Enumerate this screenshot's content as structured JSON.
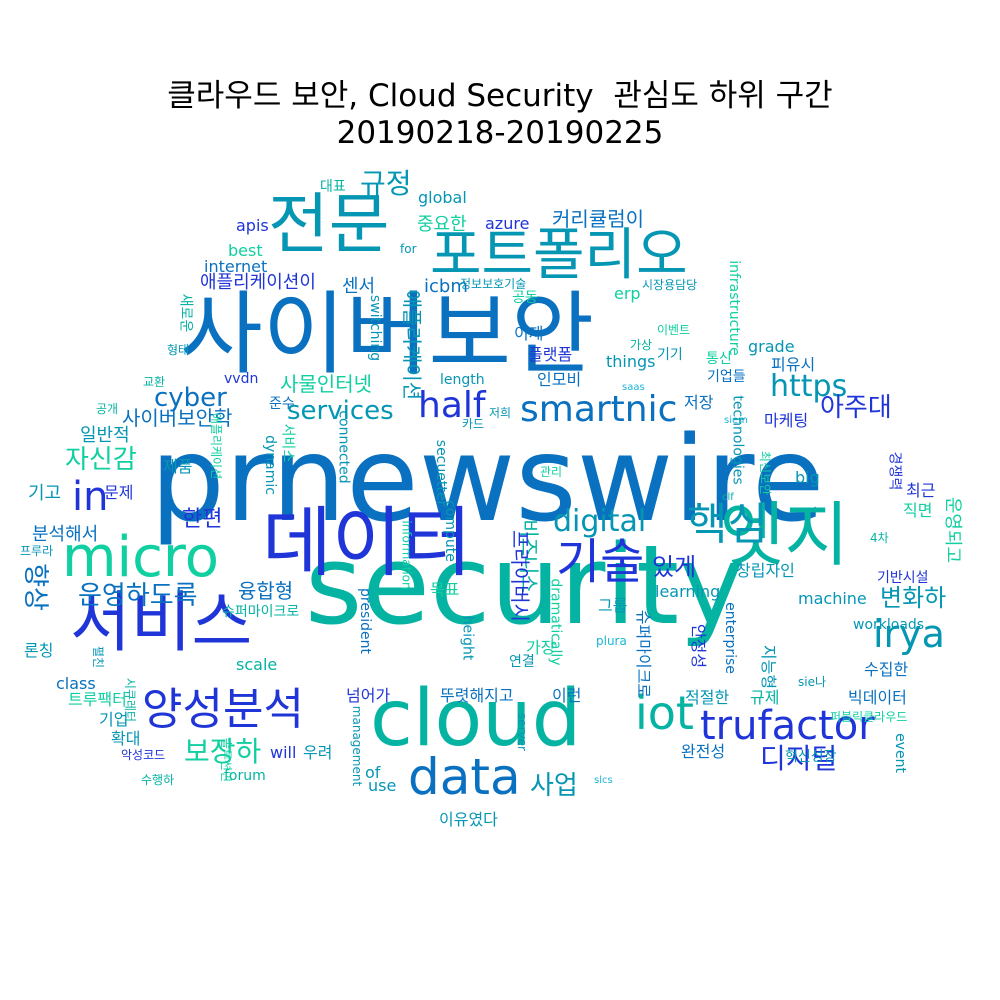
{
  "figure": {
    "title_line1": "클라우드 보안, Cloud Security  관심도 하위 구간",
    "title_line2": "20190218-20190225"
  },
  "palette": [
    "#1f35d8",
    "#0a71c0",
    "#0596b4",
    "#05b3a3",
    "#10cfa0",
    "#1ab5d6"
  ],
  "words": [
    {
      "text": "prnewswire",
      "color": "#0a71c0"
    },
    {
      "text": "security",
      "color": "#05b3a3"
    },
    {
      "text": "사이버보안",
      "color": "#0a71c0"
    },
    {
      "text": "데이터",
      "color": "#1f35d8"
    },
    {
      "text": "cloud",
      "color": "#05b3a3"
    },
    {
      "text": "서비스",
      "color": "#1f35d8"
    },
    {
      "text": "엣지",
      "color": "#05b3a3"
    },
    {
      "text": "전문",
      "color": "#0596b4"
    },
    {
      "text": "micro",
      "color": "#10cfa0"
    },
    {
      "text": "포트폴리오",
      "color": "#0596b4"
    },
    {
      "text": "data",
      "color": "#0a71c0"
    },
    {
      "text": "양성분석",
      "color": "#1f35d8"
    },
    {
      "text": "기술",
      "color": "#1f35d8"
    },
    {
      "text": "핵심",
      "color": "#0596b4"
    },
    {
      "text": "trufactor",
      "color": "#1f35d8"
    },
    {
      "text": "smartnic",
      "color": "#0a71c0"
    },
    {
      "text": "iot",
      "color": "#05b3a3"
    },
    {
      "text": "half",
      "color": "#1f35d8"
    },
    {
      "text": "irya",
      "color": "#0596b4"
    },
    {
      "text": "in",
      "color": "#1f35d8"
    },
    {
      "text": "digital",
      "color": "#0596b4"
    },
    {
      "text": "https",
      "color": "#0596b4"
    },
    {
      "text": "보장하",
      "color": "#10cfa0"
    },
    {
      "text": "디지털",
      "color": "#1f35d8"
    },
    {
      "text": "운영하도록",
      "color": "#0a71c0"
    },
    {
      "text": "사업",
      "color": "#0596b4"
    },
    {
      "text": "자신감",
      "color": "#10cfa0"
    },
    {
      "text": "services",
      "color": "#0596b4"
    },
    {
      "text": "있게",
      "color": "#1f35d8"
    },
    {
      "text": "변화하",
      "color": "#0596b4"
    },
    {
      "text": "규정",
      "color": "#0596b4"
    },
    {
      "text": "cyber",
      "color": "#0a71c0"
    },
    {
      "text": "아주대",
      "color": "#1f35d8"
    },
    {
      "text": "향상",
      "color": "#0a71c0"
    },
    {
      "text": "한편",
      "color": "#1f35d8"
    },
    {
      "text": "사물인터넷",
      "color": "#10cfa0"
    },
    {
      "text": "사이버보안학",
      "color": "#0a71c0"
    },
    {
      "text": "애플리케이션",
      "color": "#0596b4"
    },
    {
      "text": "비즈니스",
      "color": "#05b3a3"
    },
    {
      "text": "프라이버시",
      "color": "#1f35d8"
    },
    {
      "text": "융합형",
      "color": "#0a71c0"
    },
    {
      "text": "커리큘럼이",
      "color": "#0a71c0"
    },
    {
      "text": "중요한",
      "color": "#10cfa0"
    },
    {
      "text": "azure",
      "color": "#1f35d8"
    },
    {
      "text": "global",
      "color": "#0596b4"
    },
    {
      "text": "대표",
      "color": "#05b3a3"
    },
    {
      "text": "apis",
      "color": "#1f35d8"
    },
    {
      "text": "best",
      "color": "#10cfa0"
    },
    {
      "text": "for",
      "color": "#0596b4"
    },
    {
      "text": "internet",
      "color": "#0a71c0"
    },
    {
      "text": "애플리케이션이",
      "color": "#1f35d8"
    },
    {
      "text": "icbm",
      "color": "#0a71c0"
    },
    {
      "text": "정보보호기술",
      "color": "#0596b4"
    },
    {
      "text": "erp",
      "color": "#10cfa0"
    },
    {
      "text": "시장용담당",
      "color": "#0596b4"
    },
    {
      "text": "infrastructure",
      "color": "#10cfa0"
    },
    {
      "text": "센서",
      "color": "#0a71c0"
    },
    {
      "text": "공동",
      "color": "#10cfa0"
    },
    {
      "text": "switching",
      "color": "#0596b4"
    },
    {
      "text": "이제",
      "color": "#0a71c0"
    },
    {
      "text": "이벤트",
      "color": "#10cfa0"
    },
    {
      "text": "기기",
      "color": "#0596b4"
    },
    {
      "text": "가상",
      "color": "#05b3a3"
    },
    {
      "text": "grade",
      "color": "#0596b4"
    },
    {
      "text": "플랫폼",
      "color": "#1f35d8"
    },
    {
      "text": "통신",
      "color": "#10cfa0"
    },
    {
      "text": "피유시",
      "color": "#0a71c0"
    },
    {
      "text": "things",
      "color": "#0596b4"
    },
    {
      "text": "기업들",
      "color": "#0a71c0"
    },
    {
      "text": "인모비",
      "color": "#0a71c0"
    },
    {
      "text": "saas",
      "color": "#1ab5d6"
    },
    {
      "text": "vvdn",
      "color": "#1f35d8"
    },
    {
      "text": "length",
      "color": "#0596b4"
    },
    {
      "text": "준수",
      "color": "#0a71c0"
    },
    {
      "text": "저장",
      "color": "#0a71c0"
    },
    {
      "text": "마케팅",
      "color": "#1f35d8"
    },
    {
      "text": "새로운",
      "color": "#05b3a3"
    },
    {
      "text": "형태",
      "color": "#0596b4"
    },
    {
      "text": "교환",
      "color": "#05b3a3"
    },
    {
      "text": "공개",
      "color": "#05b3a3"
    },
    {
      "text": "일반적",
      "color": "#0596b4"
    },
    {
      "text": "애플리케이션",
      "color": "#10cfa0"
    },
    {
      "text": "제품",
      "color": "#0596b4"
    },
    {
      "text": "dynamic",
      "color": "#0596b4"
    },
    {
      "text": "서비스",
      "color": "#10cfa0"
    },
    {
      "text": "connected",
      "color": "#0596b4"
    },
    {
      "text": "저희",
      "color": "#0596b4"
    },
    {
      "text": "카드",
      "color": "#0596b4"
    },
    {
      "text": "siem",
      "color": "#1ab5d6"
    },
    {
      "text": "technologies",
      "color": "#0596b4"
    },
    {
      "text": "경쟁력",
      "color": "#1f35d8"
    },
    {
      "text": "big",
      "color": "#0596b4"
    },
    {
      "text": "관리",
      "color": "#10cfa0"
    },
    {
      "text": "secuetter",
      "color": "#0596b4"
    },
    {
      "text": "최신보안",
      "color": "#10cfa0"
    },
    {
      "text": "최근",
      "color": "#1f35d8"
    },
    {
      "text": "기고",
      "color": "#0596b4"
    },
    {
      "text": "문제",
      "color": "#1f35d8"
    },
    {
      "text": "clf",
      "color": "#05b3a3"
    },
    {
      "text": "직면",
      "color": "#10cfa0"
    },
    {
      "text": "운영되고",
      "color": "#10cfa0"
    },
    {
      "text": "분석해서",
      "color": "#0a71c0"
    },
    {
      "text": "information",
      "color": "#10cfa0"
    },
    {
      "text": "compute",
      "color": "#0596b4"
    },
    {
      "text": "4차",
      "color": "#05b3a3"
    },
    {
      "text": "프루라",
      "color": "#0596b4"
    },
    {
      "text": "창립자인",
      "color": "#0596b4"
    },
    {
      "text": "기반시설",
      "color": "#1f35d8"
    },
    {
      "text": "슈퍼마이크로",
      "color": "#05b3a3"
    },
    {
      "text": "president",
      "color": "#0a71c0"
    },
    {
      "text": "목표",
      "color": "#10cfa0"
    },
    {
      "text": "dramatically",
      "color": "#10cfa0"
    },
    {
      "text": "learning",
      "color": "#0596b4"
    },
    {
      "text": "그룹",
      "color": "#0596b4"
    },
    {
      "text": "machine",
      "color": "#0596b4"
    },
    {
      "text": "슈퍼마이크로",
      "color": "#0a71c0"
    },
    {
      "text": "지능형",
      "color": "#0596b4"
    },
    {
      "text": "enterprise",
      "color": "#0a71c0"
    },
    {
      "text": "plura",
      "color": "#1ab5d6"
    },
    {
      "text": "workloads",
      "color": "#0596b4"
    },
    {
      "text": "론칭",
      "color": "#0596b4"
    },
    {
      "text": "펼친",
      "color": "#0596b4"
    },
    {
      "text": "scale",
      "color": "#05b3a3"
    },
    {
      "text": "height",
      "color": "#0596b4"
    },
    {
      "text": "가장",
      "color": "#10cfa0"
    },
    {
      "text": "연결",
      "color": "#0596b4"
    },
    {
      "text": "안정성",
      "color": "#1f35d8"
    },
    {
      "text": "수집한",
      "color": "#0a71c0"
    },
    {
      "text": "class",
      "color": "#0a71c0"
    },
    {
      "text": "시큐레터",
      "color": "#05b3a3"
    },
    {
      "text": "sie나",
      "color": "#0596b4"
    },
    {
      "text": "트루팩터",
      "color": "#10cfa0"
    },
    {
      "text": "넘어가",
      "color": "#1f35d8"
    },
    {
      "text": "뚜렷해지고",
      "color": "#0a71c0"
    },
    {
      "text": "이런",
      "color": "#0a71c0"
    },
    {
      "text": "적절한",
      "color": "#0596b4"
    },
    {
      "text": "규제",
      "color": "#05b3a3"
    },
    {
      "text": "빅데이터",
      "color": "#0a71c0"
    },
    {
      "text": "퍼블릭클라우드",
      "color": "#10cfa0"
    },
    {
      "text": "기업",
      "color": "#0596b4"
    },
    {
      "text": "확대",
      "color": "#0596b4"
    },
    {
      "text": "server",
      "color": "#0596b4"
    },
    {
      "text": "management",
      "color": "#0596b4"
    },
    {
      "text": "will",
      "color": "#1f35d8"
    },
    {
      "text": "우려",
      "color": "#0596b4"
    },
    {
      "text": "완전성",
      "color": "#0a71c0"
    },
    {
      "text": "혁신성장",
      "color": "#0596b4"
    },
    {
      "text": "악성코드",
      "color": "#1f35d8"
    },
    {
      "text": "of",
      "color": "#0596b4"
    },
    {
      "text": "forum",
      "color": "#05b3a3"
    },
    {
      "text": "use",
      "color": "#0596b4"
    },
    {
      "text": "솔루션인",
      "color": "#10cfa0"
    },
    {
      "text": "slcs",
      "color": "#1ab5d6"
    },
    {
      "text": "수행하",
      "color": "#05b3a3"
    },
    {
      "text": "이유였다",
      "color": "#0596b4"
    },
    {
      "text": "event",
      "color": "#0596b4"
    }
  ]
}
